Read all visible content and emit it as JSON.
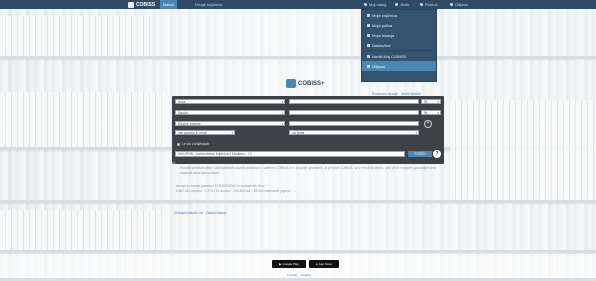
{
  "topbar": {
    "logo_text": "COBISS",
    "nav": [
      "Nalozi",
      "Druge knjižnice"
    ],
    "right_items": [
      "Moj nalog",
      "Jezik",
      "Pomoč",
      "Odjava"
    ]
  },
  "user_menu": {
    "items": [
      {
        "label": "Moja knjižnica",
        "icon": "library-icon"
      },
      {
        "label": "Moja polica",
        "icon": "shelf-icon"
      },
      {
        "label": "Moja iskanja",
        "icon": "search-icon"
      },
      {
        "label": "Nastavitve",
        "icon": "gear-icon"
      },
      {
        "label": "Izbriši Moj COBISS",
        "icon": "user-delete-icon"
      },
      {
        "label": "Odjava",
        "icon": "logout-icon"
      }
    ]
  },
  "brand": {
    "name": "COBISS+"
  },
  "top_links": [
    "Enostavno iskanje",
    "Izbirni iskalnik"
  ],
  "search_form": {
    "row1": {
      "field": "Avtor",
      "value": "",
      "op": "IN"
    },
    "row2": {
      "field": "Naslov",
      "value": "",
      "op": "IN"
    },
    "row3": {
      "field": "Ključne besede",
      "value": ""
    },
    "row4": {
      "left": "vse gradivo in enoti",
      "right": "vsi jeziki"
    },
    "available_only": "Le v/o v knjižnicah",
    "scope": "SIKLIPHB - Univerzitetna knjižnica v Mariboru - 12",
    "search_button": "POIŠČI",
    "help": "?"
  },
  "quote": "Podatki predstavljeni v bibliografskih bazah podatkov v sistemu COBISS in v skupnih seznamih, ki jih vodi COBISS, so v celoti ali delno, zato jih ni mogoče uporabljati brez soglasja upravljavca baze.",
  "stats": [
    "Iskanje po bazah podatkov COBISS/OPAC in novinarskih virov",
    "2.887.491 zapisov · 7.273.174 izvodov · 105.806 avt. · 89.525 vsebinskih pojmov · ..."
  ],
  "bottom_links": [
    "Shranjeni iskalni nizi",
    "Zadnja iskanja"
  ],
  "stores": [
    "Google Play",
    "App Store"
  ],
  "footer_links": [
    "Kontakt",
    "English"
  ]
}
